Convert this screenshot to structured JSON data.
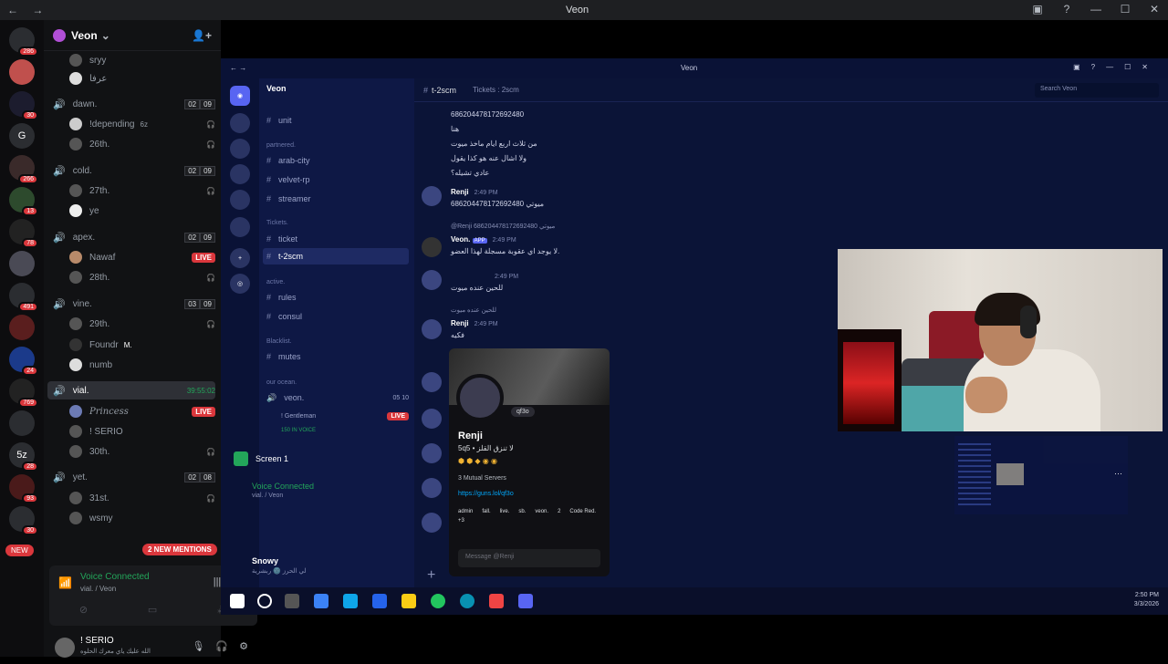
{
  "window": {
    "title": "Veon"
  },
  "guilds": {
    "new_label": "NEW",
    "items": [
      {
        "badge": "286",
        "label": ""
      },
      {
        "badge": "",
        "label": ""
      },
      {
        "badge": "30",
        "label": ""
      },
      {
        "badge": "",
        "label": "G"
      },
      {
        "badge": "266",
        "label": ""
      },
      {
        "badge": "13",
        "label": ""
      },
      {
        "badge": "78",
        "label": ""
      },
      {
        "badge": "",
        "label": ""
      },
      {
        "badge": "491",
        "label": ""
      },
      {
        "badge": "",
        "label": ""
      },
      {
        "badge": "24",
        "label": ""
      },
      {
        "badge": "769",
        "label": ""
      },
      {
        "badge": "",
        "label": ""
      },
      {
        "badge": "28",
        "label": "5z"
      },
      {
        "badge": "93",
        "label": ""
      },
      {
        "badge": "30",
        "label": ""
      }
    ]
  },
  "server": {
    "name": "Veon"
  },
  "voice_channels": [
    {
      "name": "dawn.",
      "counts": [
        "02",
        "09"
      ],
      "users": [
        {
          "name": "!depending",
          "extra": "6z"
        },
        {
          "name": "26th.",
          "extra": ""
        }
      ]
    },
    {
      "name": "cold.",
      "counts": [
        "02",
        "09"
      ],
      "users": [
        {
          "name": "27th.",
          "extra": ""
        },
        {
          "name": "ye",
          "extra": ""
        }
      ]
    },
    {
      "name": "apex.",
      "counts": [
        "02",
        "09"
      ],
      "users": [
        {
          "name": "Nawaf",
          "extra": "LIVE"
        },
        {
          "name": "28th.",
          "extra": ""
        }
      ]
    },
    {
      "name": "vine.",
      "counts": [
        "03",
        "09"
      ],
      "users": [
        {
          "name": "29th.",
          "extra": ""
        },
        {
          "name": "Foundr",
          "extra": "M."
        },
        {
          "name": "numb",
          "extra": ""
        }
      ]
    },
    {
      "name": "vial.",
      "timer": "39:55:02",
      "users": [
        {
          "name": "Princess",
          "extra": "LIVE"
        },
        {
          "name": "! SERIO",
          "extra": ""
        },
        {
          "name": "30th.",
          "extra": ""
        }
      ]
    },
    {
      "name": "yet.",
      "counts": [
        "02",
        "08"
      ],
      "users": [
        {
          "name": "31st.",
          "extra": ""
        },
        {
          "name": "wsmy",
          "extra": ""
        }
      ]
    }
  ],
  "top_users": [
    {
      "name": "sryy"
    },
    {
      "name": "عرفا"
    }
  ],
  "mentions_label": "2 NEW MENTIONS",
  "voice_panel": {
    "title": "Voice Connected",
    "subtitle": "vial. / Veon"
  },
  "user_panel": {
    "name": "! SERIO",
    "status": "الله عليك ياي معرك الحلوه"
  },
  "stream": {
    "title": "Veon",
    "server": "Veon",
    "search_placeholder": "Search Veon",
    "channel": "t-2scm",
    "topic": "Tickets : 2scm",
    "channels": {
      "unit": "unit",
      "partnered": "partnered.",
      "arab_city": "arab-city",
      "velvet": "velvet-rp",
      "streamer": "streamer",
      "tickets": "Tickets.",
      "ticket": "ticket",
      "t2scm": "t-2scm",
      "active": "active.",
      "rules": "rules",
      "consul": "consul",
      "blacklist": "Blacklist.",
      "mutes": "mutes",
      "ocean": "our ocean.",
      "veon": "veon.",
      "veon_counts": "05 10",
      "gentleman": "! Gentleman",
      "in_voice": "150 IN VOICE"
    },
    "screen_label": "Screen 1",
    "voice": {
      "title": "Voice Connected",
      "subtitle": "vial. / Veon"
    },
    "user": {
      "name": "Snowy",
      "status": "لي الحرز 🌚 ربشرية"
    },
    "messages": {
      "m1_id": "686204478172692480",
      "m1_l1": "هنا",
      "m1_l2": "من ثلاث اربع ايام ماخذ ميوت",
      "m1_l3": "ولا اشال عنه هو كذا يقول",
      "m1_l4": "عادي تشيله؟",
      "m2_name": "Renji",
      "m2_time": "2:49 PM",
      "m2_text": "686204478172692480 ميوتي",
      "m3_reply": "@Renji  686204478172692480 ميوتي",
      "m3_name": "Veon.",
      "m3_tag": "APP",
      "m3_time": "2:49 PM",
      "m3_text": "لا يوجد اي عقوبة مسجلة لهذا العضو.",
      "m4_time": "2:49 PM",
      "m4_text": "للحين عنده ميوت",
      "m5_reply": "للحين عنده ميوت",
      "m5_name": "Renji",
      "m5_time": "2:49 PM",
      "m5_text": "فكيه"
    },
    "profile": {
      "name": "Renji",
      "username": "5q5 • لا تنزق القلز",
      "pill": "qf3o",
      "mutual": "3 Mutual Servers",
      "link": "https://guns.lol/qf3o",
      "roles": [
        "admin",
        "fall.",
        "live.",
        "sb.",
        "veon.",
        "2",
        "Code Red.",
        "+3"
      ],
      "message_placeholder": "Message @Renji"
    },
    "clock": {
      "time": "2:50 PM",
      "date": "3/3/2026"
    }
  }
}
